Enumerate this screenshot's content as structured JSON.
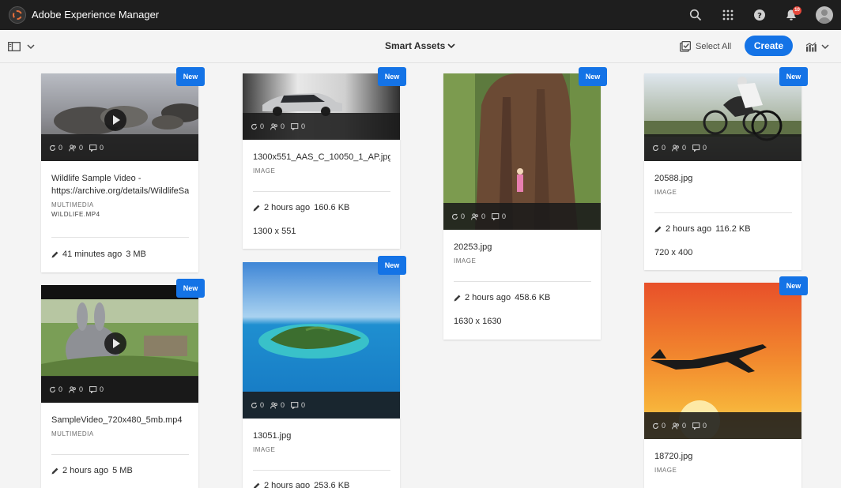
{
  "shell": {
    "title": "Adobe Experience Manager",
    "notification_count": "10",
    "icons": [
      "search-icon",
      "apps-grid-icon",
      "help-icon",
      "bell-icon",
      "user-avatar-icon"
    ]
  },
  "actionbar": {
    "title": "Smart Assets",
    "select_all": "Select All",
    "create": "Create"
  },
  "colors": {
    "accent": "#1473e6",
    "shell": "#1e1e1e",
    "background": "#f4f4f4",
    "badge": "#e5483b"
  },
  "new_label": "New",
  "cards": [
    {
      "name": "Wildlife Sample Video - https://archive.org/details/WildlifeSa",
      "type": "MULTIMEDIA",
      "subtype": "WILDLIFE.MP4",
      "time": "41 minutes ago",
      "size": "3 MB",
      "dims": "",
      "counts": [
        "0",
        "0",
        "0"
      ]
    },
    {
      "name": "1300x551_AAS_C_10050_1_AP.jpg",
      "type": "IMAGE",
      "subtype": "",
      "time": "2 hours ago",
      "size": "160.6 KB",
      "dims": "1300 x 551",
      "counts": [
        "0",
        "0",
        "0"
      ]
    },
    {
      "name": "20253.jpg",
      "type": "IMAGE",
      "subtype": "",
      "time": "2 hours ago",
      "size": "458.6 KB",
      "dims": "1630 x 1630",
      "counts": [
        "0",
        "0",
        "0"
      ]
    },
    {
      "name": "20588.jpg",
      "type": "IMAGE",
      "subtype": "",
      "time": "2 hours ago",
      "size": "116.2 KB",
      "dims": "720 x 400",
      "counts": [
        "0",
        "0",
        "0"
      ]
    },
    {
      "name": "SampleVideo_720x480_5mb.mp4",
      "type": "MULTIMEDIA",
      "subtype": "",
      "time": "2 hours ago",
      "size": "5 MB",
      "dims": "",
      "counts": [
        "0",
        "0",
        "0"
      ]
    },
    {
      "name": "13051.jpg",
      "type": "IMAGE",
      "subtype": "",
      "time": "2 hours ago",
      "size": "253.6 KB",
      "dims": "",
      "counts": [
        "0",
        "0",
        "0"
      ]
    },
    {
      "name": "18720.jpg",
      "type": "IMAGE",
      "subtype": "",
      "time": "",
      "size": "",
      "dims": "",
      "counts": [
        "0",
        "0",
        "0"
      ]
    }
  ]
}
